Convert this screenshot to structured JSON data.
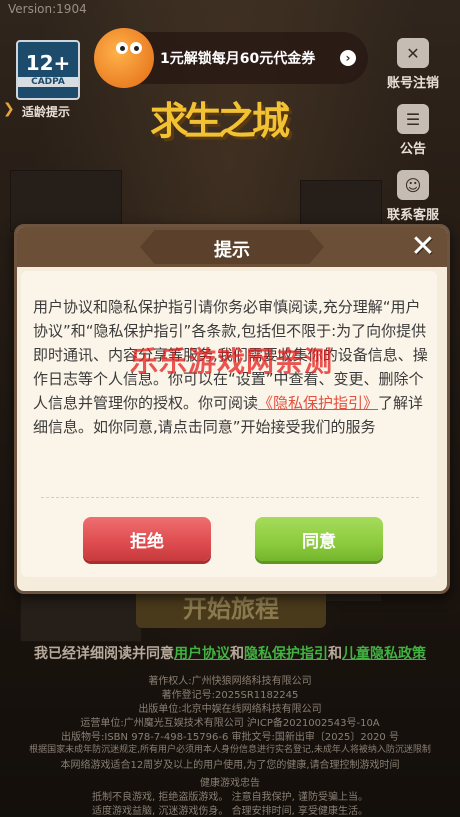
{
  "version": "Version:1904",
  "age_badge": {
    "age": "12+",
    "org": "CADPA",
    "hint": "适龄提示"
  },
  "promo": {
    "text": "1元解锁每月60元代金券"
  },
  "side_menu": [
    {
      "label": "账号注销",
      "icon": "account-cancel-icon"
    },
    {
      "label": "公告",
      "icon": "notice-icon"
    },
    {
      "label": "联系客服",
      "icon": "customer-service-icon"
    }
  ],
  "game_logo": "求生之城",
  "start_button": "开始旅程",
  "dialog": {
    "title": "提示",
    "body_pre": "用户协议和隐私保护指引请你务必审慎阅读,充分理解“用户协议”和“隐私保护指引”各条款,包括但不限于:为了向你提供即时通讯、内容分享等服务,我们需要收集你的设备信息、操作日志等个人信息。你可以在“设置”中查看、变更、删除个人信息并管理你的授权。你可阅读",
    "privacy_link": "《隐私保护指引》",
    "body_post": "了解详细信息。如你同意,请点击同意”开始接受我们的服务",
    "reject_label": "拒绝",
    "agree_label": "同意"
  },
  "watermark": "乐乐游戏网亲测",
  "agree_line": {
    "prefix": "我已经详细阅读并同意",
    "user_agreement": "用户协议",
    "and1": "和",
    "privacy_policy": "隐私保护指引",
    "and2": "和",
    "child_policy": "儿童隐私政策"
  },
  "credits": [
    "著作权人:广州快狼网络科技有限公司",
    "著作登记号:2025SR1182245",
    "出版单位:北京中娱在线网络科技有限公司",
    "运营单位:广州魔光互娱技术有限公司 沪ICP备2021002543号-10A",
    "出版物号:ISBN 978-7-498-15796-6 审批文号:国新出审〔2025〕2020 号",
    "根据国家未成年防沉迷规定,所有用户必须用本人身份信息进行实名登记,未成年人将被纳入防沉迷限制",
    "本网络游戏适合12周岁及以上的用户使用,为了您的健康,请合理控制游戏时间",
    "健康游戏忠告",
    "抵制不良游戏,  拒绝盗版游戏。  注意自我保护,  谨防受骗上当。",
    "适度游戏益脑,  沉迷游戏伤身。  合理安排时间,  享受健康生活。"
  ]
}
